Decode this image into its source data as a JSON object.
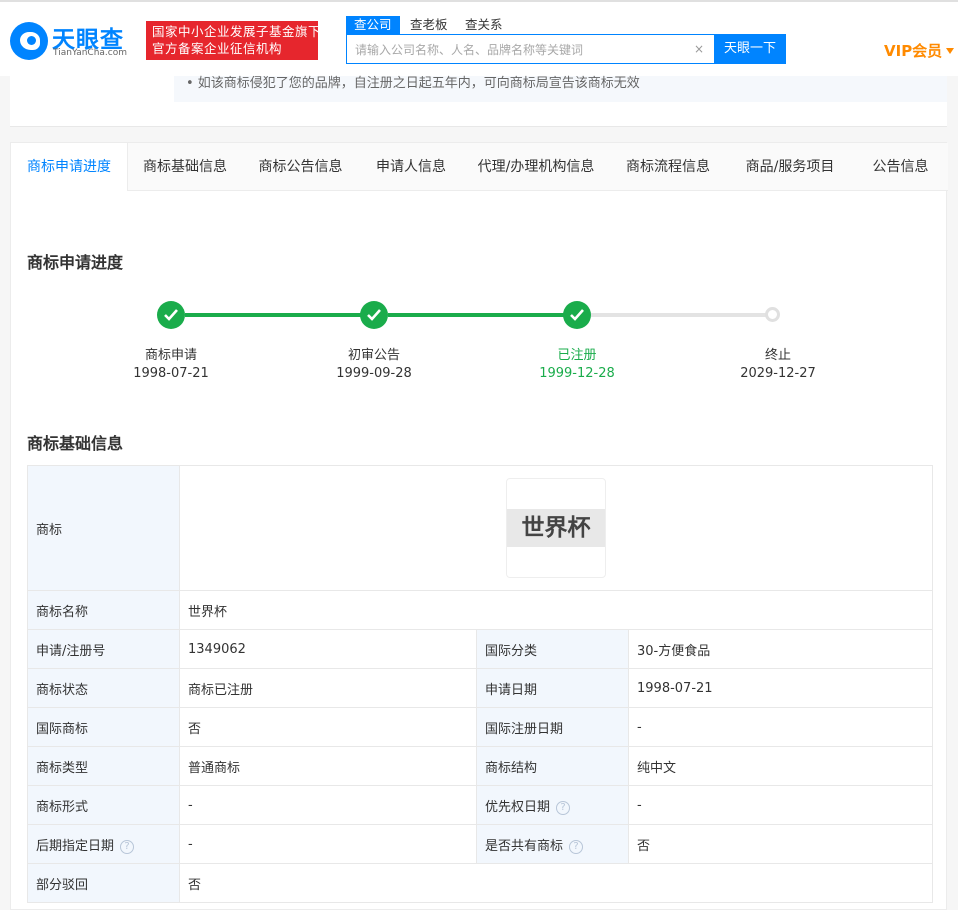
{
  "header": {
    "logo_cn": "天眼查",
    "logo_en": "TianYanCha.com",
    "slogan_line1": "国家中小企业发展子基金旗下",
    "slogan_line2": "官方备案企业征信机构",
    "search_tabs": [
      "查公司",
      "查老板",
      "查关系"
    ],
    "search_placeholder": "请输入公司名称、人名、品牌名称等关键词",
    "search_clear": "×",
    "search_button": "天眼一下",
    "vip_label": "VIP会员",
    "brand_color": "#0084ff"
  },
  "notice": {
    "text": "• 如该商标侵犯了您的品牌，自注册之日起五年内，可向商标局宣告该商标无效"
  },
  "tabs": [
    "商标申请进度",
    "商标基础信息",
    "商标公告信息",
    "申请人信息",
    "代理/办理机构信息",
    "商标流程信息",
    "商品/服务项目",
    "公告信息"
  ],
  "progress": {
    "title": "商标申请进度",
    "steps": [
      {
        "label": "商标申请",
        "date": "1998-07-21",
        "status": "done"
      },
      {
        "label": "初审公告",
        "date": "1999-09-28",
        "status": "done"
      },
      {
        "label": "已注册",
        "date": "1999-12-28",
        "status": "current"
      },
      {
        "label": "终止",
        "date": "2029-12-27",
        "status": "pending"
      }
    ],
    "done_color": "#1aac4b"
  },
  "basic": {
    "title": "商标基础信息",
    "logo_label": "商标",
    "logo_text": "世界杯",
    "name_label": "商标名称",
    "name_value": "世界杯",
    "rows": [
      {
        "l1": "申请/注册号",
        "v1": "1349062",
        "l2": "国际分类",
        "v2": "30-方便食品"
      },
      {
        "l1": "商标状态",
        "v1": "商标已注册",
        "l2": "申请日期",
        "v2": "1998-07-21"
      },
      {
        "l1": "国际商标",
        "v1": "否",
        "l2": "国际注册日期",
        "v2": "-"
      },
      {
        "l1": "商标类型",
        "v1": "普通商标",
        "l2": "商标结构",
        "v2": "纯中文"
      },
      {
        "l1": "商标形式",
        "v1": "-",
        "l2": "优先权日期",
        "v2": "-"
      },
      {
        "l1": "后期指定日期",
        "v1": "-",
        "l2": "是否共有商标",
        "v2": "否"
      }
    ],
    "reject_label": "部分驳回",
    "reject_value": "否",
    "help_icon": "?"
  }
}
